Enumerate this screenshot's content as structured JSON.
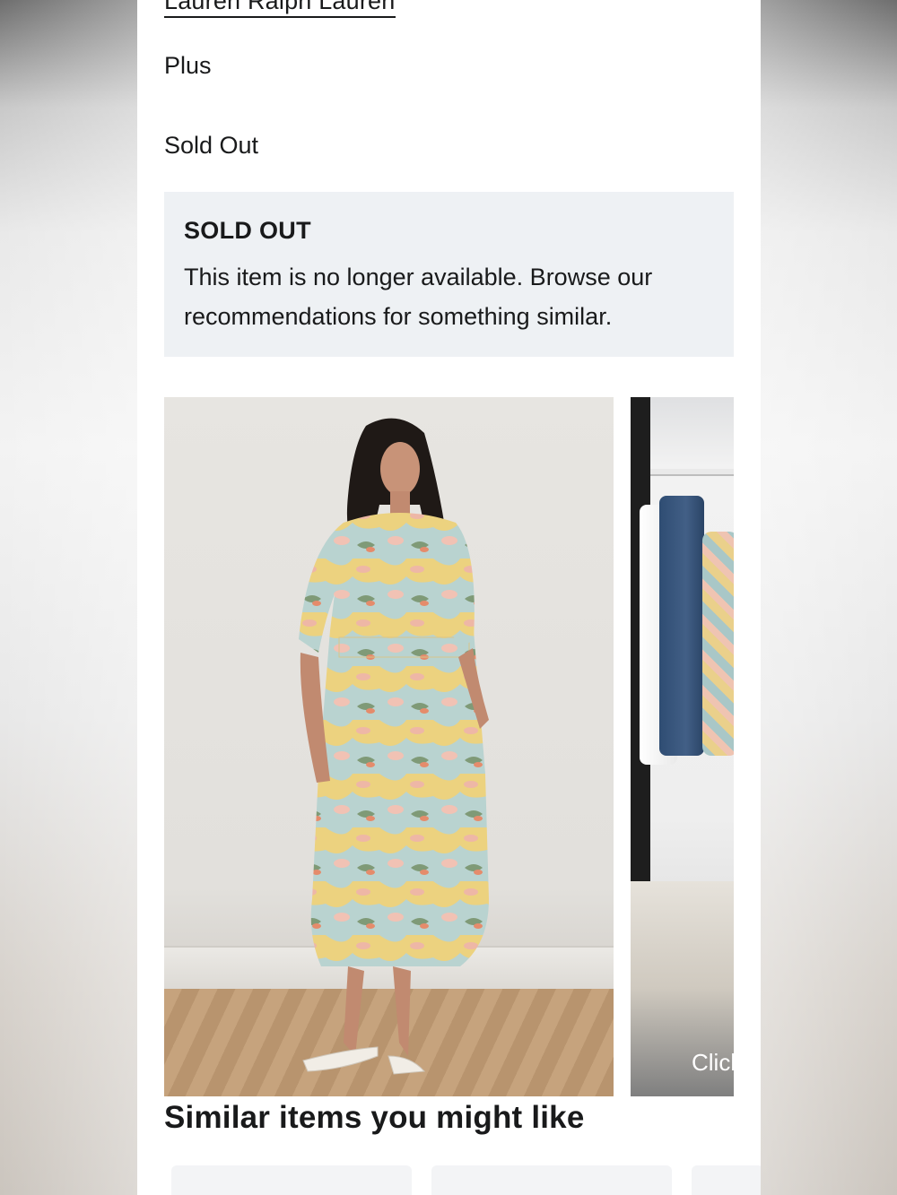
{
  "product": {
    "brand": "Lauren Ralph Lauren",
    "size_type": "Plus",
    "availability": "Sold Out"
  },
  "notice": {
    "title": "SOLD OUT",
    "message": "This item is no longer available. Browse our recommendations for something similar."
  },
  "media": {
    "video_overlay_label": "Click"
  },
  "recommendations": {
    "heading": "Similar items you might like"
  }
}
